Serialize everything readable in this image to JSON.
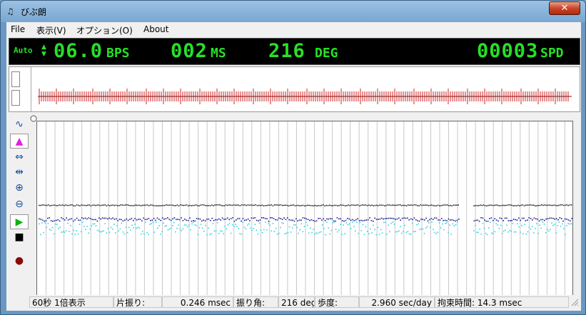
{
  "window": {
    "title": "びぶ朗",
    "close_label": "✕"
  },
  "menu": {
    "items": [
      "File",
      "表示(V)",
      "オプション(O)",
      "About"
    ]
  },
  "led": {
    "mode": "Auto",
    "bps_value": "06.0",
    "bps_unit": "BPS",
    "ms_value": "002",
    "ms_unit": "MS",
    "deg_value": "216",
    "deg_unit": "DEG",
    "spd_value": "00003",
    "spd_unit": "SPD"
  },
  "status": {
    "range": "60秒 1倍表示",
    "amplitude_label": "片振り:",
    "amplitude_value": "0.246 msec",
    "angle_label": "振り角:",
    "angle_value": "216 deg",
    "rate_label": "歩度:",
    "rate_value": "2.960 sec/day",
    "lock_label": "拘束時間: 14.3 msec"
  },
  "colors": {
    "led_green": "#27e027",
    "trace_dark": "#111111",
    "trace_blue": "#1a1a8c",
    "trace_cyan": "#2ad4e8",
    "wave_red": "#d62020"
  }
}
